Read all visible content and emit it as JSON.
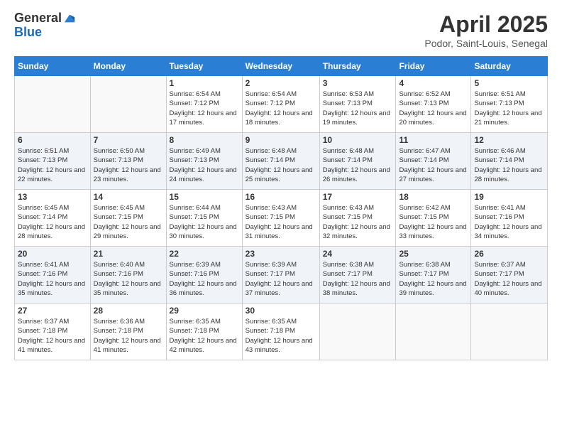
{
  "logo": {
    "general": "General",
    "blue": "Blue"
  },
  "title": "April 2025",
  "location": "Podor, Saint-Louis, Senegal",
  "days_of_week": [
    "Sunday",
    "Monday",
    "Tuesday",
    "Wednesday",
    "Thursday",
    "Friday",
    "Saturday"
  ],
  "weeks": [
    [
      {
        "day": "",
        "info": ""
      },
      {
        "day": "",
        "info": ""
      },
      {
        "day": "1",
        "info": "Sunrise: 6:54 AM\nSunset: 7:12 PM\nDaylight: 12 hours and 17 minutes."
      },
      {
        "day": "2",
        "info": "Sunrise: 6:54 AM\nSunset: 7:12 PM\nDaylight: 12 hours and 18 minutes."
      },
      {
        "day": "3",
        "info": "Sunrise: 6:53 AM\nSunset: 7:13 PM\nDaylight: 12 hours and 19 minutes."
      },
      {
        "day": "4",
        "info": "Sunrise: 6:52 AM\nSunset: 7:13 PM\nDaylight: 12 hours and 20 minutes."
      },
      {
        "day": "5",
        "info": "Sunrise: 6:51 AM\nSunset: 7:13 PM\nDaylight: 12 hours and 21 minutes."
      }
    ],
    [
      {
        "day": "6",
        "info": "Sunrise: 6:51 AM\nSunset: 7:13 PM\nDaylight: 12 hours and 22 minutes."
      },
      {
        "day": "7",
        "info": "Sunrise: 6:50 AM\nSunset: 7:13 PM\nDaylight: 12 hours and 23 minutes."
      },
      {
        "day": "8",
        "info": "Sunrise: 6:49 AM\nSunset: 7:13 PM\nDaylight: 12 hours and 24 minutes."
      },
      {
        "day": "9",
        "info": "Sunrise: 6:48 AM\nSunset: 7:14 PM\nDaylight: 12 hours and 25 minutes."
      },
      {
        "day": "10",
        "info": "Sunrise: 6:48 AM\nSunset: 7:14 PM\nDaylight: 12 hours and 26 minutes."
      },
      {
        "day": "11",
        "info": "Sunrise: 6:47 AM\nSunset: 7:14 PM\nDaylight: 12 hours and 27 minutes."
      },
      {
        "day": "12",
        "info": "Sunrise: 6:46 AM\nSunset: 7:14 PM\nDaylight: 12 hours and 28 minutes."
      }
    ],
    [
      {
        "day": "13",
        "info": "Sunrise: 6:45 AM\nSunset: 7:14 PM\nDaylight: 12 hours and 28 minutes."
      },
      {
        "day": "14",
        "info": "Sunrise: 6:45 AM\nSunset: 7:15 PM\nDaylight: 12 hours and 29 minutes."
      },
      {
        "day": "15",
        "info": "Sunrise: 6:44 AM\nSunset: 7:15 PM\nDaylight: 12 hours and 30 minutes."
      },
      {
        "day": "16",
        "info": "Sunrise: 6:43 AM\nSunset: 7:15 PM\nDaylight: 12 hours and 31 minutes."
      },
      {
        "day": "17",
        "info": "Sunrise: 6:43 AM\nSunset: 7:15 PM\nDaylight: 12 hours and 32 minutes."
      },
      {
        "day": "18",
        "info": "Sunrise: 6:42 AM\nSunset: 7:15 PM\nDaylight: 12 hours and 33 minutes."
      },
      {
        "day": "19",
        "info": "Sunrise: 6:41 AM\nSunset: 7:16 PM\nDaylight: 12 hours and 34 minutes."
      }
    ],
    [
      {
        "day": "20",
        "info": "Sunrise: 6:41 AM\nSunset: 7:16 PM\nDaylight: 12 hours and 35 minutes."
      },
      {
        "day": "21",
        "info": "Sunrise: 6:40 AM\nSunset: 7:16 PM\nDaylight: 12 hours and 35 minutes."
      },
      {
        "day": "22",
        "info": "Sunrise: 6:39 AM\nSunset: 7:16 PM\nDaylight: 12 hours and 36 minutes."
      },
      {
        "day": "23",
        "info": "Sunrise: 6:39 AM\nSunset: 7:17 PM\nDaylight: 12 hours and 37 minutes."
      },
      {
        "day": "24",
        "info": "Sunrise: 6:38 AM\nSunset: 7:17 PM\nDaylight: 12 hours and 38 minutes."
      },
      {
        "day": "25",
        "info": "Sunrise: 6:38 AM\nSunset: 7:17 PM\nDaylight: 12 hours and 39 minutes."
      },
      {
        "day": "26",
        "info": "Sunrise: 6:37 AM\nSunset: 7:17 PM\nDaylight: 12 hours and 40 minutes."
      }
    ],
    [
      {
        "day": "27",
        "info": "Sunrise: 6:37 AM\nSunset: 7:18 PM\nDaylight: 12 hours and 41 minutes."
      },
      {
        "day": "28",
        "info": "Sunrise: 6:36 AM\nSunset: 7:18 PM\nDaylight: 12 hours and 41 minutes."
      },
      {
        "day": "29",
        "info": "Sunrise: 6:35 AM\nSunset: 7:18 PM\nDaylight: 12 hours and 42 minutes."
      },
      {
        "day": "30",
        "info": "Sunrise: 6:35 AM\nSunset: 7:18 PM\nDaylight: 12 hours and 43 minutes."
      },
      {
        "day": "",
        "info": ""
      },
      {
        "day": "",
        "info": ""
      },
      {
        "day": "",
        "info": ""
      }
    ]
  ]
}
